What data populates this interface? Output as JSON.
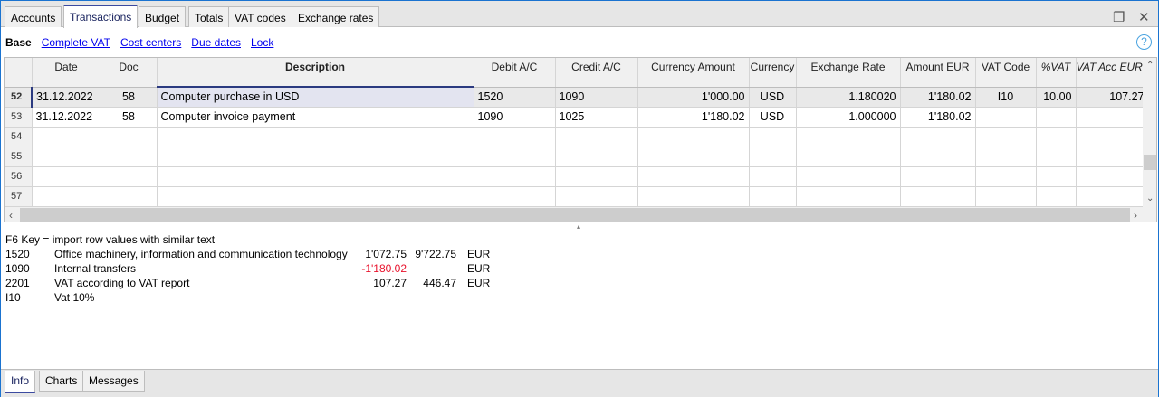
{
  "tabs": [
    "Accounts",
    "Transactions",
    "Budget",
    "Totals",
    "VAT codes",
    "Exchange rates"
  ],
  "active_tab": "Transactions",
  "views": {
    "base": "Base",
    "links": [
      "Complete VAT",
      "Cost centers",
      "Due dates",
      "Lock"
    ]
  },
  "help_label": "?",
  "columns": [
    "Date",
    "Doc",
    "Description",
    "Debit A/C",
    "Credit A/C",
    "Currency Amount",
    "Currency",
    "Exchange Rate",
    "Amount EUR",
    "VAT Code",
    "%VAT",
    "VAT Acc EUR"
  ],
  "rows": [
    {
      "n": "52",
      "date": "31.12.2022",
      "doc": "58",
      "desc": "Computer purchase in USD",
      "debit": "1520",
      "credit": "1090",
      "camount": "1'000.00",
      "currency": "USD",
      "rate": "1.180020",
      "amount": "1'180.02",
      "vatcode": "I10",
      "vatpct": "10.00",
      "vatacc": "107.27"
    },
    {
      "n": "53",
      "date": "31.12.2022",
      "doc": "58",
      "desc": "Computer invoice payment",
      "debit": "1090",
      "credit": "1025",
      "camount": "1'180.02",
      "currency": "USD",
      "rate": "1.000000",
      "amount": "1'180.02",
      "vatcode": "",
      "vatpct": "",
      "vatacc": ""
    },
    {
      "n": "54"
    },
    {
      "n": "55"
    },
    {
      "n": "56"
    },
    {
      "n": "57"
    }
  ],
  "info": {
    "hint": "F6 Key = import row values with similar text",
    "lines": [
      {
        "code": "1520",
        "text": "Office machinery, information and communication technology",
        "a": "1'072.75",
        "b": "9'722.75",
        "cur": "EUR"
      },
      {
        "code": "1090",
        "text": "Internal transfers",
        "a": "-1'180.02",
        "b": "",
        "cur": "EUR"
      },
      {
        "code": "2201",
        "text": "VAT according to VAT report",
        "a": "107.27",
        "b": "446.47",
        "cur": "EUR"
      },
      {
        "code": "I10",
        "text": "Vat 10%",
        "a": "",
        "b": "",
        "cur": ""
      }
    ]
  },
  "bottom_tabs": [
    "Info",
    "Charts",
    "Messages"
  ],
  "colors": {
    "negative": "#e8102a",
    "link": "#0000ee",
    "accent": "#2b3a80"
  }
}
